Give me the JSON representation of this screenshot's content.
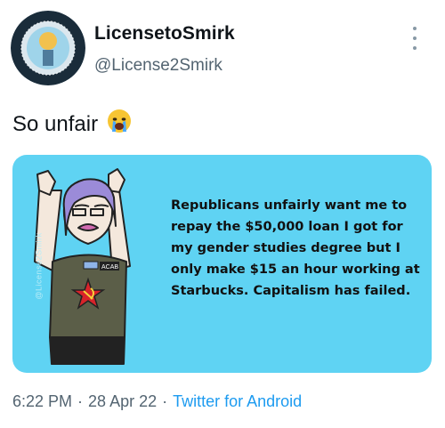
{
  "user": {
    "display_name": "LicensetoSmirk",
    "handle": "@License2Smirk",
    "avatar_text_top": "The current thing",
    "avatar_text_bottom": "is probably a psyop"
  },
  "tweet": {
    "text": "So unfair",
    "emoji": "loudly-crying-face"
  },
  "media": {
    "background_color": "#5fd3f3",
    "caption": "Republicans unfairly want me to repay the $50,000 loan I got for my gender studies degree but I only make $15 an hour working at Starbucks. Capitalism has failed.",
    "watermark": "@License2Smirk",
    "badge_text": "ACAB"
  },
  "meta": {
    "time": "6:22 PM",
    "date": "28 Apr 22",
    "separator": "·",
    "source": "Twitter for Android"
  },
  "icons": {
    "more": "more-vertical-icon"
  }
}
